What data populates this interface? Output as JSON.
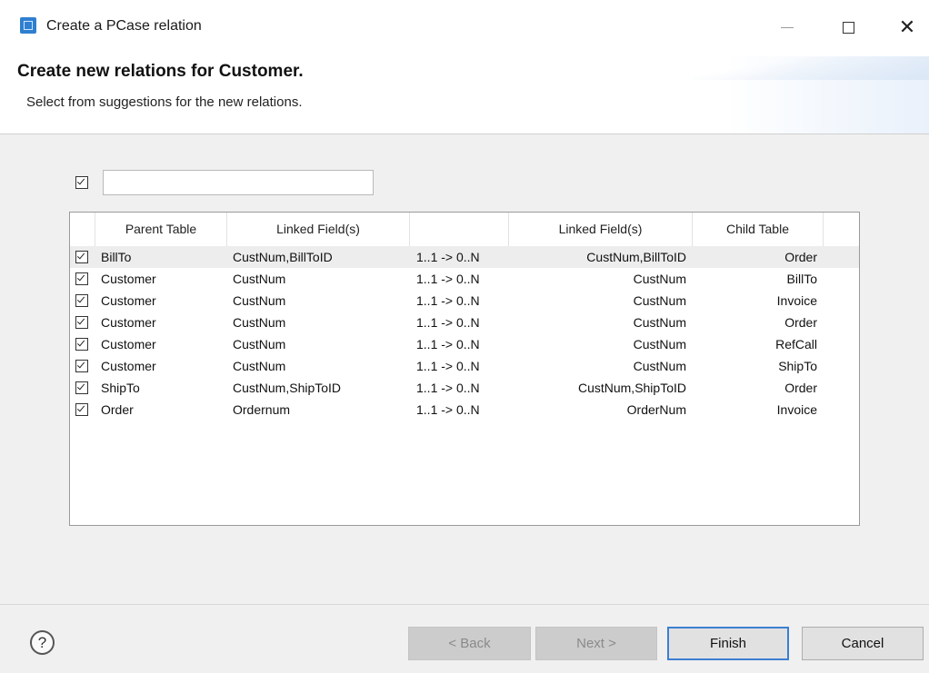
{
  "window": {
    "title": "Create a PCase relation",
    "close_glyph": "✕"
  },
  "header": {
    "heading": "Create new relations for Customer.",
    "subheading": "Select from suggestions for the new relations."
  },
  "filter": {
    "select_all_checked": true,
    "value": ""
  },
  "table": {
    "columns": [
      "Parent Table",
      "Linked Field(s)",
      "",
      "Linked Field(s)",
      "Child Table"
    ],
    "rows": [
      {
        "checked": true,
        "parent": "BillTo",
        "linked_parent": "CustNum,BillToID",
        "cardinality": "1..1 -> 0..N",
        "linked_child": "CustNum,BillToID",
        "child": "Order"
      },
      {
        "checked": true,
        "parent": "Customer",
        "linked_parent": "CustNum",
        "cardinality": "1..1 -> 0..N",
        "linked_child": "CustNum",
        "child": "BillTo"
      },
      {
        "checked": true,
        "parent": "Customer",
        "linked_parent": "CustNum",
        "cardinality": "1..1 -> 0..N",
        "linked_child": "CustNum",
        "child": "Invoice"
      },
      {
        "checked": true,
        "parent": "Customer",
        "linked_parent": "CustNum",
        "cardinality": "1..1 -> 0..N",
        "linked_child": "CustNum",
        "child": "Order"
      },
      {
        "checked": true,
        "parent": "Customer",
        "linked_parent": "CustNum",
        "cardinality": "1..1 -> 0..N",
        "linked_child": "CustNum",
        "child": "RefCall"
      },
      {
        "checked": true,
        "parent": "Customer",
        "linked_parent": "CustNum",
        "cardinality": "1..1 -> 0..N",
        "linked_child": "CustNum",
        "child": "ShipTo"
      },
      {
        "checked": true,
        "parent": "ShipTo",
        "linked_parent": "CustNum,ShipToID",
        "cardinality": "1..1 -> 0..N",
        "linked_child": "CustNum,ShipToID",
        "child": "Order"
      },
      {
        "checked": true,
        "parent": "Order",
        "linked_parent": "Ordernum",
        "cardinality": "1..1 -> 0..N",
        "linked_child": "OrderNum",
        "child": "Invoice"
      }
    ]
  },
  "footer": {
    "help_glyph": "?",
    "back_label": "< Back",
    "next_label": "Next >",
    "finish_label": "Finish",
    "cancel_label": "Cancel"
  }
}
